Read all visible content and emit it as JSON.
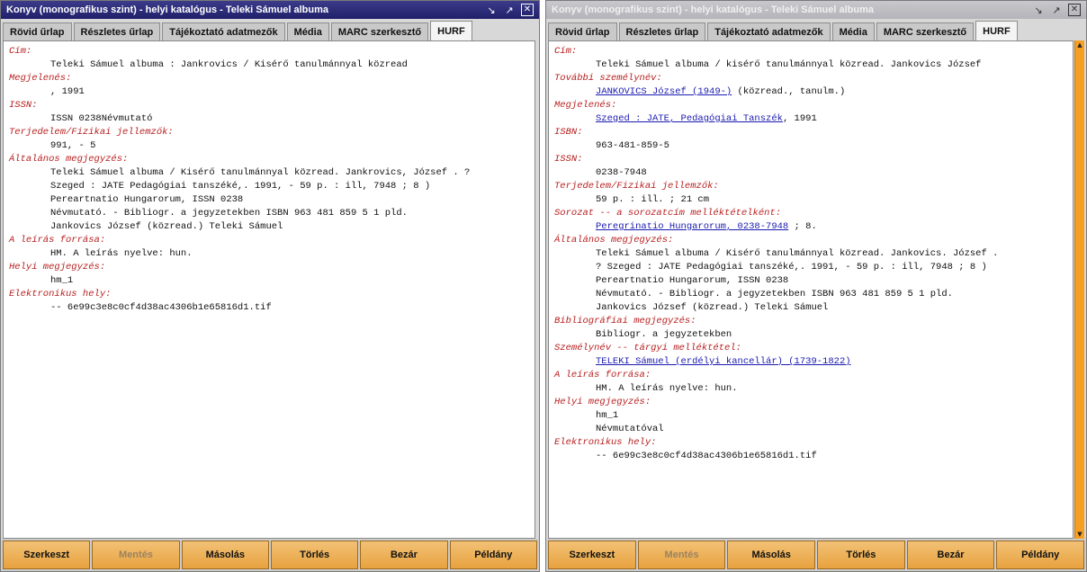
{
  "left": {
    "title": "Konyv (monografikus szint) - helyi katalógus - Teleki Sámuel albuma",
    "tabs": [
      "Rövid űrlap",
      "Részletes űrlap",
      "Tájékoztató adatmezők",
      "Média",
      "MARC szerkesztő",
      "HURF"
    ],
    "active_tab": "HURF",
    "fields": [
      {
        "label": "Cím:",
        "values": [
          "Teleki Sámuel albuma : Jankrovics / Kisérő tanulmánnyal közread"
        ]
      },
      {
        "label": "Megjelenés:",
        "values": [
          ", 1991"
        ]
      },
      {
        "label": "ISSN:",
        "values": [
          "ISSN 0238Névmutató"
        ]
      },
      {
        "label": "Terjedelem/Fizikai jellemzők:",
        "values": [
          "991, - 5"
        ]
      },
      {
        "label": "Általános megjegyzés:",
        "values": [
          "Teleki Sámuel albuma / Kisérő tanulmánnyal közread. Jankrovics, József . ?",
          "Szeged : JATE Pedagógiai tanszéké,. 1991, - 59 p. : ill, 7948 ; 8 )",
          "Pereartnatio Hungarorum, ISSN 0238",
          "Névmutató. - Bibliogr. a jegyzetekben ISBN 963 481 859 5 1 pld.",
          "Jankovics József (közread.) Teleki Sámuel"
        ]
      },
      {
        "label": "A leírás forrása:",
        "values": [
          "HM. A leírás nyelve: hun."
        ]
      },
      {
        "label": "Helyi megjegyzés:",
        "values": [
          "hm_1"
        ]
      },
      {
        "label": "Elektronikus hely:",
        "values": [
          "-- 6e99c3e8c0cf4d38ac4306b1e65816d1.tif"
        ]
      }
    ],
    "buttons": [
      "Szerkeszt",
      "Mentés",
      "Másolás",
      "Törlés",
      "Bezár",
      "Példány"
    ],
    "disabled_button": "Mentés"
  },
  "right": {
    "title": "Konyv (monografikus szint) - helyi katalógus - Teleki Sámuel albuma",
    "tabs": [
      "Rövid űrlap",
      "Részletes űrlap",
      "Tájékoztató adatmezők",
      "Média",
      "MARC szerkesztő",
      "HURF"
    ],
    "active_tab": "HURF",
    "fields": [
      {
        "label": "Cím:",
        "values": [
          "Teleki Sámuel albuma / kisérő tanulmánnyal közread. Jankovics József"
        ]
      },
      {
        "label": "További személynév:",
        "values": [
          {
            "link": "JANKOVICS József (1949-)",
            "rest": " (közread., tanulm.)"
          }
        ]
      },
      {
        "label": "Megjelenés:",
        "values": [
          {
            "link": "Szeged : JATE, Pedagógiai Tanszék",
            "rest": ", 1991"
          }
        ]
      },
      {
        "label": "ISBN:",
        "values": [
          "963-481-859-5"
        ]
      },
      {
        "label": "ISSN:",
        "values": [
          "0238-7948"
        ]
      },
      {
        "label": "Terjedelem/Fizikai jellemzők:",
        "values": [
          "59 p. : ill. ; 21 cm"
        ]
      },
      {
        "label": "Sorozat -- a sorozatcím melléktételként:",
        "values": [
          {
            "link": "Peregrinatio Hungarorum, 0238-7948",
            "rest": " ; 8."
          }
        ]
      },
      {
        "label": "Általános megjegyzés:",
        "values": [
          "Teleki Sámuel albuma / Kisérő tanulmánnyal közread. Jankovics. József .",
          "? Szeged : JATE Pedagógiai tanszéké,. 1991, - 59 p. : ill, 7948 ; 8 )",
          "Pereartnatio Hungarorum, ISSN 0238",
          "Névmutató. - Bibliogr. a jegyzetekben ISBN 963 481 859 5 1 pld.",
          "Jankovics József (közread.) Teleki Sámuel"
        ]
      },
      {
        "label": "Bibliográfiai megjegyzés:",
        "values": [
          "Bibliogr. a jegyzetekben"
        ]
      },
      {
        "label": "Személynév -- tárgyi melléktétel:",
        "values": [
          {
            "link": "TELEKI Sámuel (erdélyi kancellár) (1739-1822)",
            "rest": ""
          }
        ]
      },
      {
        "label": "A leírás forrása:",
        "values": [
          "HM. A leírás nyelve: hun."
        ]
      },
      {
        "label": "Helyi megjegyzés:",
        "values": [
          "hm_1",
          "Névmutatóval"
        ]
      },
      {
        "label": "Elektronikus hely:",
        "values": [
          "-- 6e99c3e8c0cf4d38ac4306b1e65816d1.tif"
        ]
      }
    ],
    "buttons": [
      "Szerkeszt",
      "Mentés",
      "Másolás",
      "Törlés",
      "Bezár",
      "Példány"
    ],
    "disabled_button": "Mentés"
  },
  "icons": {
    "restore": "restore-icon",
    "maximize": "maximize-icon",
    "close": "close-icon",
    "scroll_up": "scroll-up-arrow-icon",
    "scroll_down": "scroll-down-arrow-icon"
  },
  "colors": {
    "field_label": "#b82020",
    "link": "#1a1ab0",
    "button": "#e8a23f",
    "active_title": "#20206a",
    "scrollbar": "#f6a023"
  }
}
